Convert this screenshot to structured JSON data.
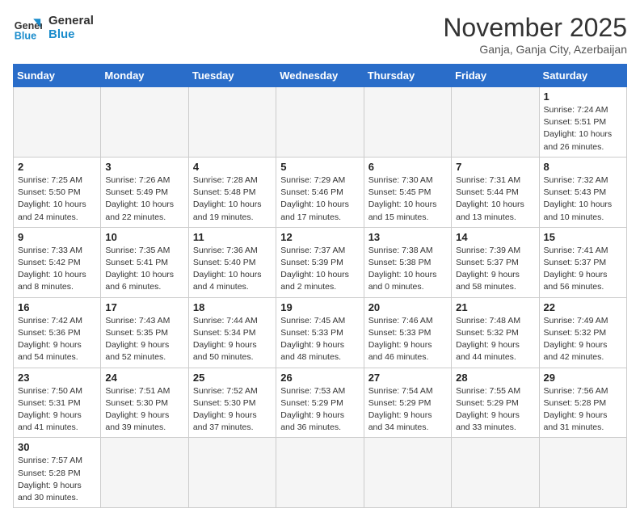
{
  "logo": {
    "text_general": "General",
    "text_blue": "Blue"
  },
  "title": "November 2025",
  "subtitle": "Ganja, Ganja City, Azerbaijan",
  "weekdays": [
    "Sunday",
    "Monday",
    "Tuesday",
    "Wednesday",
    "Thursday",
    "Friday",
    "Saturday"
  ],
  "weeks": [
    [
      {
        "day": "",
        "info": ""
      },
      {
        "day": "",
        "info": ""
      },
      {
        "day": "",
        "info": ""
      },
      {
        "day": "",
        "info": ""
      },
      {
        "day": "",
        "info": ""
      },
      {
        "day": "",
        "info": ""
      },
      {
        "day": "1",
        "info": "Sunrise: 7:24 AM\nSunset: 5:51 PM\nDaylight: 10 hours and 26 minutes."
      }
    ],
    [
      {
        "day": "2",
        "info": "Sunrise: 7:25 AM\nSunset: 5:50 PM\nDaylight: 10 hours and 24 minutes."
      },
      {
        "day": "3",
        "info": "Sunrise: 7:26 AM\nSunset: 5:49 PM\nDaylight: 10 hours and 22 minutes."
      },
      {
        "day": "4",
        "info": "Sunrise: 7:28 AM\nSunset: 5:48 PM\nDaylight: 10 hours and 19 minutes."
      },
      {
        "day": "5",
        "info": "Sunrise: 7:29 AM\nSunset: 5:46 PM\nDaylight: 10 hours and 17 minutes."
      },
      {
        "day": "6",
        "info": "Sunrise: 7:30 AM\nSunset: 5:45 PM\nDaylight: 10 hours and 15 minutes."
      },
      {
        "day": "7",
        "info": "Sunrise: 7:31 AM\nSunset: 5:44 PM\nDaylight: 10 hours and 13 minutes."
      },
      {
        "day": "8",
        "info": "Sunrise: 7:32 AM\nSunset: 5:43 PM\nDaylight: 10 hours and 10 minutes."
      }
    ],
    [
      {
        "day": "9",
        "info": "Sunrise: 7:33 AM\nSunset: 5:42 PM\nDaylight: 10 hours and 8 minutes."
      },
      {
        "day": "10",
        "info": "Sunrise: 7:35 AM\nSunset: 5:41 PM\nDaylight: 10 hours and 6 minutes."
      },
      {
        "day": "11",
        "info": "Sunrise: 7:36 AM\nSunset: 5:40 PM\nDaylight: 10 hours and 4 minutes."
      },
      {
        "day": "12",
        "info": "Sunrise: 7:37 AM\nSunset: 5:39 PM\nDaylight: 10 hours and 2 minutes."
      },
      {
        "day": "13",
        "info": "Sunrise: 7:38 AM\nSunset: 5:38 PM\nDaylight: 10 hours and 0 minutes."
      },
      {
        "day": "14",
        "info": "Sunrise: 7:39 AM\nSunset: 5:37 PM\nDaylight: 9 hours and 58 minutes."
      },
      {
        "day": "15",
        "info": "Sunrise: 7:41 AM\nSunset: 5:37 PM\nDaylight: 9 hours and 56 minutes."
      }
    ],
    [
      {
        "day": "16",
        "info": "Sunrise: 7:42 AM\nSunset: 5:36 PM\nDaylight: 9 hours and 54 minutes."
      },
      {
        "day": "17",
        "info": "Sunrise: 7:43 AM\nSunset: 5:35 PM\nDaylight: 9 hours and 52 minutes."
      },
      {
        "day": "18",
        "info": "Sunrise: 7:44 AM\nSunset: 5:34 PM\nDaylight: 9 hours and 50 minutes."
      },
      {
        "day": "19",
        "info": "Sunrise: 7:45 AM\nSunset: 5:33 PM\nDaylight: 9 hours and 48 minutes."
      },
      {
        "day": "20",
        "info": "Sunrise: 7:46 AM\nSunset: 5:33 PM\nDaylight: 9 hours and 46 minutes."
      },
      {
        "day": "21",
        "info": "Sunrise: 7:48 AM\nSunset: 5:32 PM\nDaylight: 9 hours and 44 minutes."
      },
      {
        "day": "22",
        "info": "Sunrise: 7:49 AM\nSunset: 5:32 PM\nDaylight: 9 hours and 42 minutes."
      }
    ],
    [
      {
        "day": "23",
        "info": "Sunrise: 7:50 AM\nSunset: 5:31 PM\nDaylight: 9 hours and 41 minutes."
      },
      {
        "day": "24",
        "info": "Sunrise: 7:51 AM\nSunset: 5:30 PM\nDaylight: 9 hours and 39 minutes."
      },
      {
        "day": "25",
        "info": "Sunrise: 7:52 AM\nSunset: 5:30 PM\nDaylight: 9 hours and 37 minutes."
      },
      {
        "day": "26",
        "info": "Sunrise: 7:53 AM\nSunset: 5:29 PM\nDaylight: 9 hours and 36 minutes."
      },
      {
        "day": "27",
        "info": "Sunrise: 7:54 AM\nSunset: 5:29 PM\nDaylight: 9 hours and 34 minutes."
      },
      {
        "day": "28",
        "info": "Sunrise: 7:55 AM\nSunset: 5:29 PM\nDaylight: 9 hours and 33 minutes."
      },
      {
        "day": "29",
        "info": "Sunrise: 7:56 AM\nSunset: 5:28 PM\nDaylight: 9 hours and 31 minutes."
      }
    ],
    [
      {
        "day": "30",
        "info": "Sunrise: 7:57 AM\nSunset: 5:28 PM\nDaylight: 9 hours and 30 minutes."
      },
      {
        "day": "",
        "info": ""
      },
      {
        "day": "",
        "info": ""
      },
      {
        "day": "",
        "info": ""
      },
      {
        "day": "",
        "info": ""
      },
      {
        "day": "",
        "info": ""
      },
      {
        "day": "",
        "info": ""
      }
    ]
  ]
}
